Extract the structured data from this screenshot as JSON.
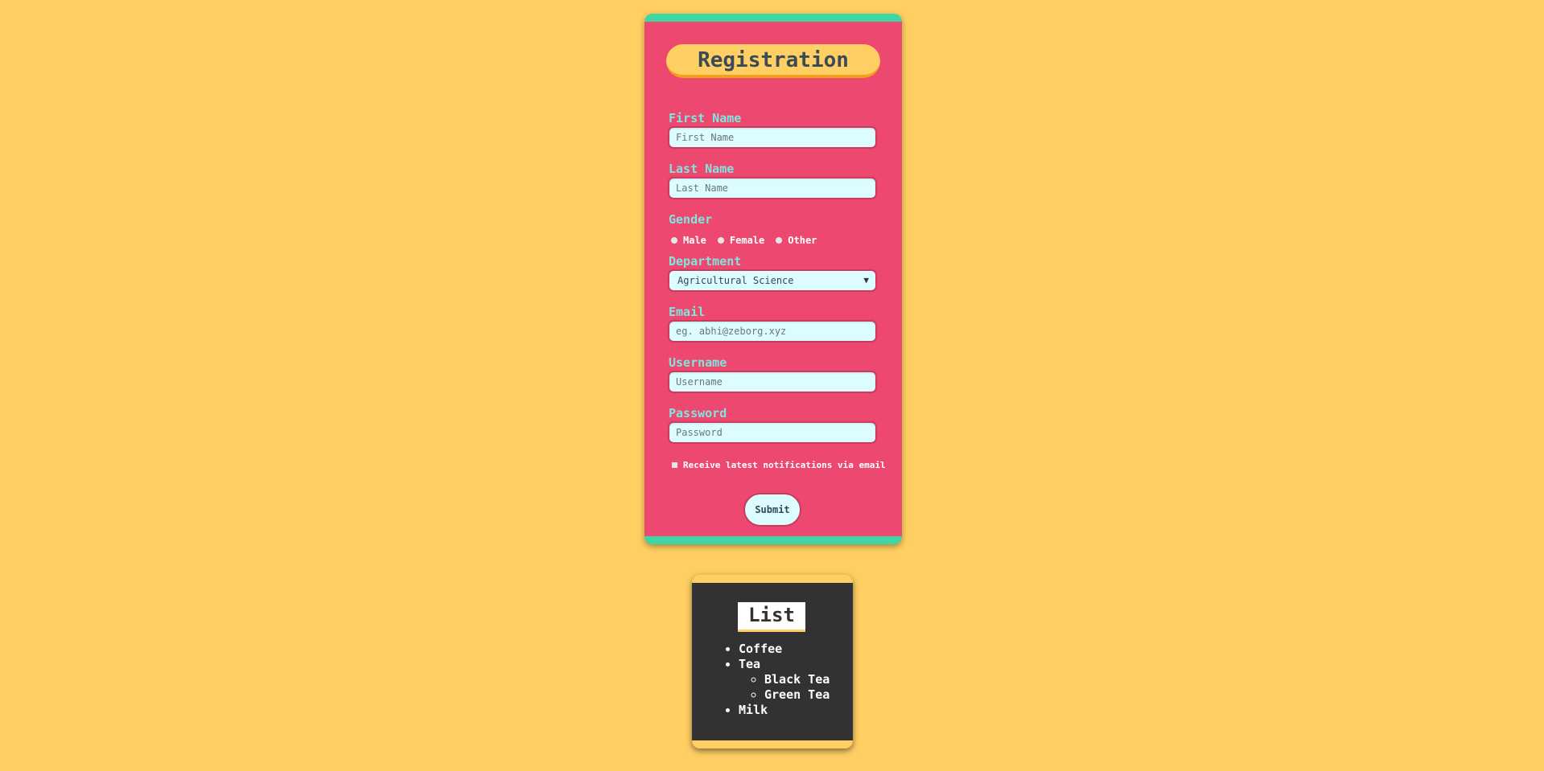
{
  "form": {
    "title": "Registration",
    "first_name": {
      "label": "First Name",
      "placeholder": "First Name"
    },
    "last_name": {
      "label": "Last Name",
      "placeholder": "Last Name"
    },
    "gender": {
      "label": "Gender",
      "options": [
        "Male",
        "Female",
        "Other"
      ]
    },
    "department": {
      "label": "Department",
      "selected": "Agricultural Science"
    },
    "email": {
      "label": "Email",
      "placeholder": "eg. abhi@zeborg.xyz"
    },
    "username": {
      "label": "Username",
      "placeholder": "Username"
    },
    "password": {
      "label": "Password",
      "placeholder": "Password"
    },
    "notifications_label": "Receive latest notifications via email",
    "submit_label": "Submit"
  },
  "list_card": {
    "title": "List",
    "items": [
      "Coffee",
      "Tea",
      "Milk"
    ],
    "tea_subitems": [
      "Black Tea",
      "Green Tea"
    ]
  },
  "colors": {
    "background": "#ffcf63",
    "form_bg": "#ec4870",
    "form_accent": "#3ed6a4",
    "label": "#7fe6df",
    "input_bg": "#dcfcff",
    "list_bg": "#323234"
  }
}
